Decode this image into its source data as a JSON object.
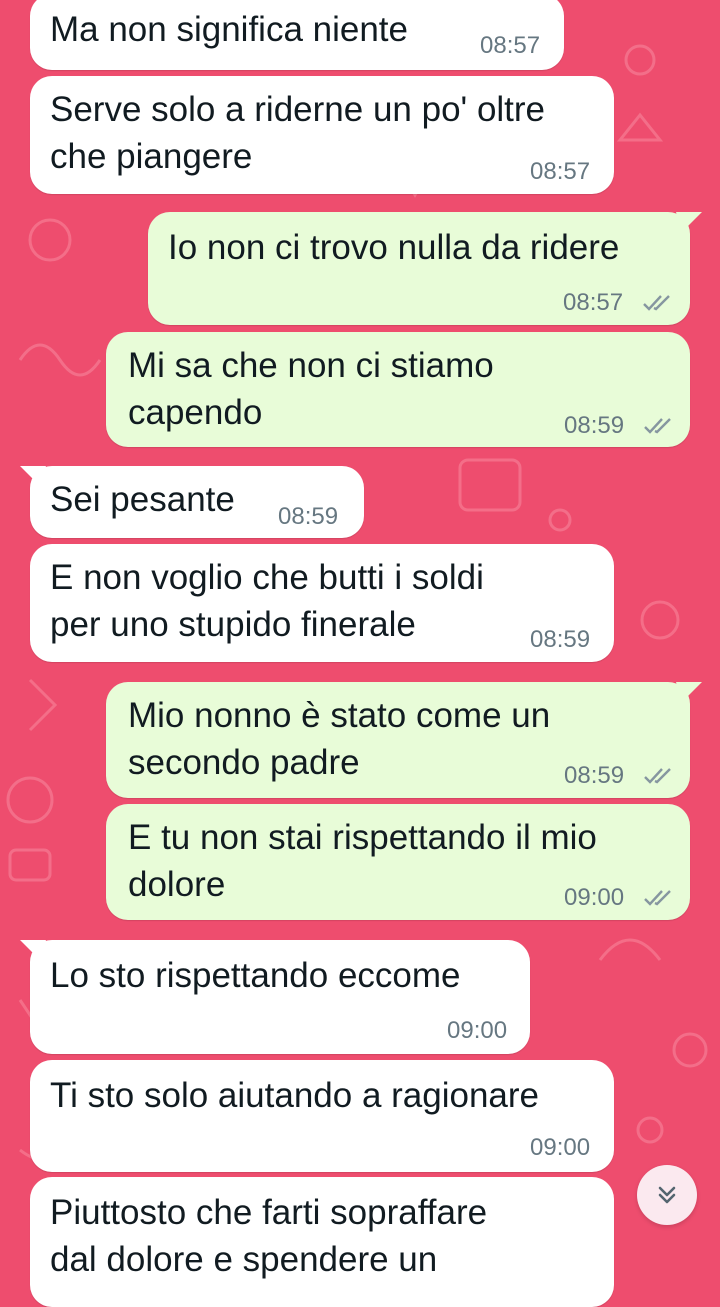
{
  "messages": [
    {
      "id": "m1",
      "direction": "in",
      "text": "Ma non significa niente",
      "time": "08:57"
    },
    {
      "id": "m2",
      "direction": "in",
      "text": "Serve solo a riderne un po' oltre\nche piangere",
      "time": "08:57"
    },
    {
      "id": "m3",
      "direction": "out",
      "text": "Io non ci trovo nulla da ridere",
      "time": "08:57",
      "status": "read"
    },
    {
      "id": "m4",
      "direction": "out",
      "text": "Mi sa che non ci stiamo\ncapendo",
      "time": "08:59",
      "status": "read"
    },
    {
      "id": "m5",
      "direction": "in",
      "text": "Sei pesante",
      "time": "08:59"
    },
    {
      "id": "m6",
      "direction": "in",
      "text": "E non voglio che butti i soldi\nper uno stupido finerale",
      "time": "08:59"
    },
    {
      "id": "m7",
      "direction": "out",
      "text": "Mio nonno è stato come un\nsecondo padre",
      "time": "08:59",
      "status": "read"
    },
    {
      "id": "m8",
      "direction": "out",
      "text": "E tu non stai rispettando il mio\ndolore",
      "time": "09:00",
      "status": "read"
    },
    {
      "id": "m9",
      "direction": "in",
      "text": "Lo sto rispettando eccome",
      "time": "09:00"
    },
    {
      "id": "m10",
      "direction": "in",
      "text": "Ti sto solo aiutando a ragionare",
      "time": "09:00"
    },
    {
      "id": "m11",
      "direction": "in",
      "text": "Piuttosto che farti sopraffare\ndal dolore e spendere un",
      "time": ""
    }
  ],
  "colors": {
    "wallpaper": "#ee4d6e",
    "incoming_bubble": "#ffffff",
    "outgoing_bubble": "#e8fcd8",
    "read_ticks": "#8696a0"
  },
  "scroll_button": {
    "icon": "double-chevron-down-icon"
  }
}
